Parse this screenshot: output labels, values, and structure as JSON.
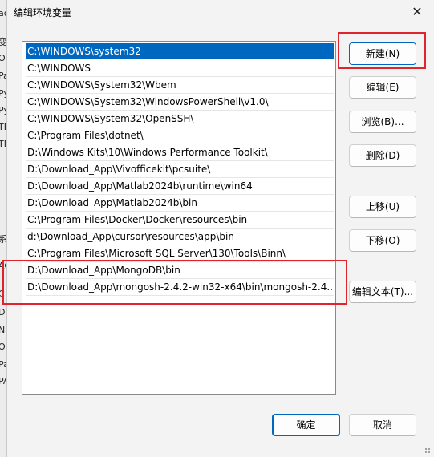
{
  "dialog": {
    "title": "编辑环境变量",
    "close_glyph": "✕"
  },
  "background": {
    "fragments": [
      "ac",
      "变",
      "Oi",
      "Pa",
      "Py",
      "Py",
      "TE",
      "TM",
      "系",
      "AC",
      "C",
      "Di",
      "N",
      "O:",
      "Pa",
      "PA"
    ]
  },
  "paths": [
    "C:\\WINDOWS\\system32",
    "C:\\WINDOWS",
    "C:\\WINDOWS\\System32\\Wbem",
    "C:\\WINDOWS\\System32\\WindowsPowerShell\\v1.0\\",
    "C:\\WINDOWS\\System32\\OpenSSH\\",
    "C:\\Program Files\\dotnet\\",
    "D:\\Windows Kits\\10\\Windows Performance Toolkit\\",
    "D:\\Download_App\\Vivofficekit\\pcsuite\\",
    "D:\\Download_App\\Matlab2024b\\runtime\\win64",
    "D:\\Download_App\\Matlab2024b\\bin",
    "C:\\Program Files\\Docker\\Docker\\resources\\bin",
    "d:\\Download_App\\cursor\\resources\\app\\bin",
    "C:\\Program Files\\Microsoft SQL Server\\130\\Tools\\Binn\\",
    "D:\\Download_App\\MongoDB\\bin",
    "D:\\Download_App\\mongosh-2.4.2-win32-x64\\bin\\mongosh-2.4...."
  ],
  "selected_index": 0,
  "buttons": {
    "new": "新建(N)",
    "edit": "编辑(E)",
    "browse": "浏览(B)...",
    "delete": "删除(D)",
    "move_up": "上移(U)",
    "move_down": "下移(O)",
    "edit_text": "编辑文本(T)...",
    "ok": "确定",
    "cancel": "取消"
  },
  "colors": {
    "selection": "#0067c0",
    "highlight_annotation": "#e0242d"
  }
}
